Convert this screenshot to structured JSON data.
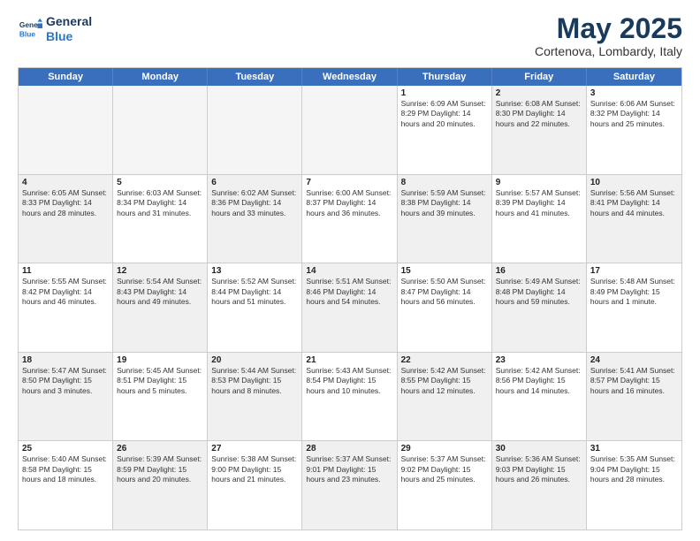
{
  "header": {
    "logo_line1": "General",
    "logo_line2": "Blue",
    "month": "May 2025",
    "location": "Cortenova, Lombardy, Italy"
  },
  "dayHeaders": [
    "Sunday",
    "Monday",
    "Tuesday",
    "Wednesday",
    "Thursday",
    "Friday",
    "Saturday"
  ],
  "weeks": [
    [
      {
        "day": "",
        "info": "",
        "empty": true
      },
      {
        "day": "",
        "info": "",
        "empty": true
      },
      {
        "day": "",
        "info": "",
        "empty": true
      },
      {
        "day": "",
        "info": "",
        "empty": true
      },
      {
        "day": "1",
        "info": "Sunrise: 6:09 AM\nSunset: 8:29 PM\nDaylight: 14 hours\nand 20 minutes.",
        "empty": false,
        "shaded": false
      },
      {
        "day": "2",
        "info": "Sunrise: 6:08 AM\nSunset: 8:30 PM\nDaylight: 14 hours\nand 22 minutes.",
        "empty": false,
        "shaded": true
      },
      {
        "day": "3",
        "info": "Sunrise: 6:06 AM\nSunset: 8:32 PM\nDaylight: 14 hours\nand 25 minutes.",
        "empty": false,
        "shaded": false
      }
    ],
    [
      {
        "day": "4",
        "info": "Sunrise: 6:05 AM\nSunset: 8:33 PM\nDaylight: 14 hours\nand 28 minutes.",
        "empty": false,
        "shaded": true
      },
      {
        "day": "5",
        "info": "Sunrise: 6:03 AM\nSunset: 8:34 PM\nDaylight: 14 hours\nand 31 minutes.",
        "empty": false,
        "shaded": false
      },
      {
        "day": "6",
        "info": "Sunrise: 6:02 AM\nSunset: 8:36 PM\nDaylight: 14 hours\nand 33 minutes.",
        "empty": false,
        "shaded": true
      },
      {
        "day": "7",
        "info": "Sunrise: 6:00 AM\nSunset: 8:37 PM\nDaylight: 14 hours\nand 36 minutes.",
        "empty": false,
        "shaded": false
      },
      {
        "day": "8",
        "info": "Sunrise: 5:59 AM\nSunset: 8:38 PM\nDaylight: 14 hours\nand 39 minutes.",
        "empty": false,
        "shaded": true
      },
      {
        "day": "9",
        "info": "Sunrise: 5:57 AM\nSunset: 8:39 PM\nDaylight: 14 hours\nand 41 minutes.",
        "empty": false,
        "shaded": false
      },
      {
        "day": "10",
        "info": "Sunrise: 5:56 AM\nSunset: 8:41 PM\nDaylight: 14 hours\nand 44 minutes.",
        "empty": false,
        "shaded": true
      }
    ],
    [
      {
        "day": "11",
        "info": "Sunrise: 5:55 AM\nSunset: 8:42 PM\nDaylight: 14 hours\nand 46 minutes.",
        "empty": false,
        "shaded": false
      },
      {
        "day": "12",
        "info": "Sunrise: 5:54 AM\nSunset: 8:43 PM\nDaylight: 14 hours\nand 49 minutes.",
        "empty": false,
        "shaded": true
      },
      {
        "day": "13",
        "info": "Sunrise: 5:52 AM\nSunset: 8:44 PM\nDaylight: 14 hours\nand 51 minutes.",
        "empty": false,
        "shaded": false
      },
      {
        "day": "14",
        "info": "Sunrise: 5:51 AM\nSunset: 8:46 PM\nDaylight: 14 hours\nand 54 minutes.",
        "empty": false,
        "shaded": true
      },
      {
        "day": "15",
        "info": "Sunrise: 5:50 AM\nSunset: 8:47 PM\nDaylight: 14 hours\nand 56 minutes.",
        "empty": false,
        "shaded": false
      },
      {
        "day": "16",
        "info": "Sunrise: 5:49 AM\nSunset: 8:48 PM\nDaylight: 14 hours\nand 59 minutes.",
        "empty": false,
        "shaded": true
      },
      {
        "day": "17",
        "info": "Sunrise: 5:48 AM\nSunset: 8:49 PM\nDaylight: 15 hours\nand 1 minute.",
        "empty": false,
        "shaded": false
      }
    ],
    [
      {
        "day": "18",
        "info": "Sunrise: 5:47 AM\nSunset: 8:50 PM\nDaylight: 15 hours\nand 3 minutes.",
        "empty": false,
        "shaded": true
      },
      {
        "day": "19",
        "info": "Sunrise: 5:45 AM\nSunset: 8:51 PM\nDaylight: 15 hours\nand 5 minutes.",
        "empty": false,
        "shaded": false
      },
      {
        "day": "20",
        "info": "Sunrise: 5:44 AM\nSunset: 8:53 PM\nDaylight: 15 hours\nand 8 minutes.",
        "empty": false,
        "shaded": true
      },
      {
        "day": "21",
        "info": "Sunrise: 5:43 AM\nSunset: 8:54 PM\nDaylight: 15 hours\nand 10 minutes.",
        "empty": false,
        "shaded": false
      },
      {
        "day": "22",
        "info": "Sunrise: 5:42 AM\nSunset: 8:55 PM\nDaylight: 15 hours\nand 12 minutes.",
        "empty": false,
        "shaded": true
      },
      {
        "day": "23",
        "info": "Sunrise: 5:42 AM\nSunset: 8:56 PM\nDaylight: 15 hours\nand 14 minutes.",
        "empty": false,
        "shaded": false
      },
      {
        "day": "24",
        "info": "Sunrise: 5:41 AM\nSunset: 8:57 PM\nDaylight: 15 hours\nand 16 minutes.",
        "empty": false,
        "shaded": true
      }
    ],
    [
      {
        "day": "25",
        "info": "Sunrise: 5:40 AM\nSunset: 8:58 PM\nDaylight: 15 hours\nand 18 minutes.",
        "empty": false,
        "shaded": false
      },
      {
        "day": "26",
        "info": "Sunrise: 5:39 AM\nSunset: 8:59 PM\nDaylight: 15 hours\nand 20 minutes.",
        "empty": false,
        "shaded": true
      },
      {
        "day": "27",
        "info": "Sunrise: 5:38 AM\nSunset: 9:00 PM\nDaylight: 15 hours\nand 21 minutes.",
        "empty": false,
        "shaded": false
      },
      {
        "day": "28",
        "info": "Sunrise: 5:37 AM\nSunset: 9:01 PM\nDaylight: 15 hours\nand 23 minutes.",
        "empty": false,
        "shaded": true
      },
      {
        "day": "29",
        "info": "Sunrise: 5:37 AM\nSunset: 9:02 PM\nDaylight: 15 hours\nand 25 minutes.",
        "empty": false,
        "shaded": false
      },
      {
        "day": "30",
        "info": "Sunrise: 5:36 AM\nSunset: 9:03 PM\nDaylight: 15 hours\nand 26 minutes.",
        "empty": false,
        "shaded": true
      },
      {
        "day": "31",
        "info": "Sunrise: 5:35 AM\nSunset: 9:04 PM\nDaylight: 15 hours\nand 28 minutes.",
        "empty": false,
        "shaded": false
      }
    ]
  ]
}
